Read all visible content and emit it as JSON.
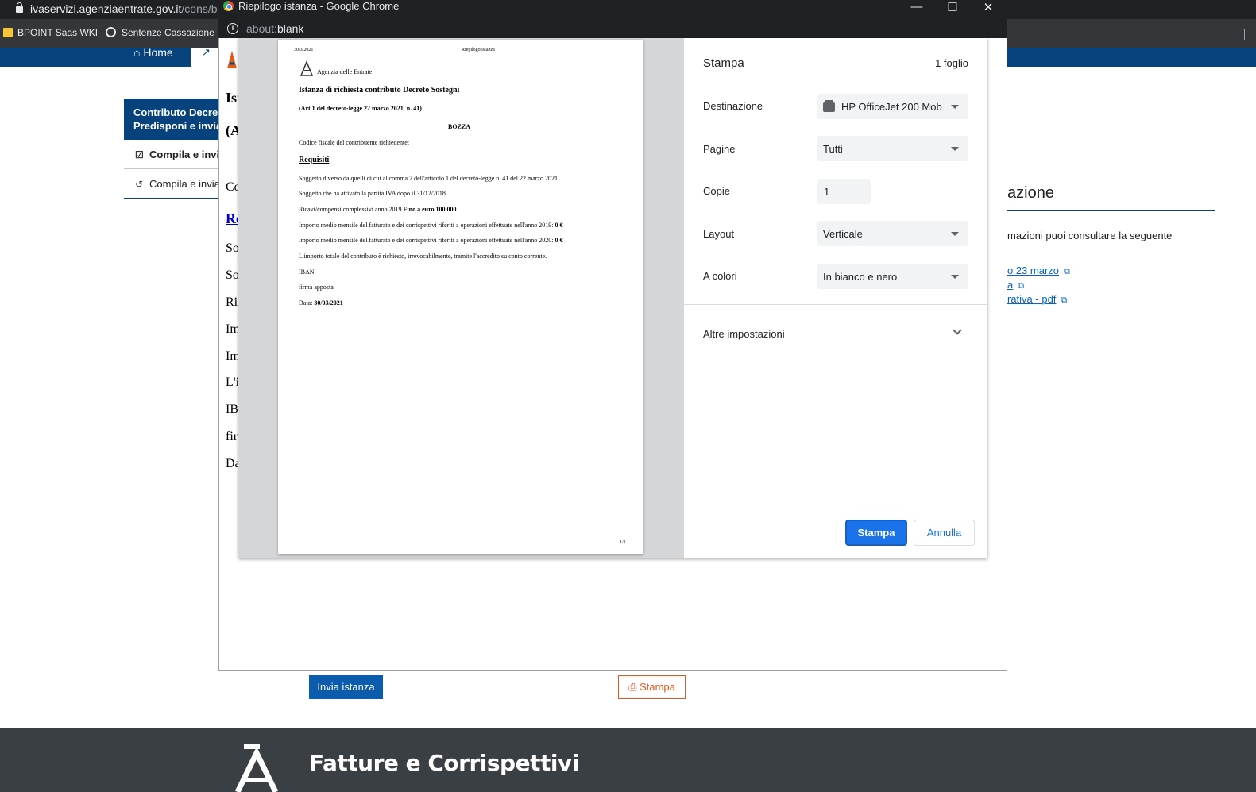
{
  "background_browser": {
    "url_host": "ivaservizi.agenziaentrate.gov.it",
    "url_path": "/cons/bc",
    "bookmarks": [
      "BPOINT Saas WKI",
      "Sentenze Cassazione"
    ]
  },
  "site": {
    "nav": {
      "home": "Home"
    },
    "sidebar": {
      "title_line1": "Contributo Decreto",
      "title_line2": "Predisponi e invia",
      "items": [
        "Compila e invia",
        "Compila e invia"
      ]
    },
    "right_panel": {
      "title": "azione",
      "text": "mazioni puoi consultare la seguente",
      "links": [
        "o 23 marzo",
        "a",
        "rativa - pdf"
      ]
    },
    "popup_underlay": {
      "h1": "Ist",
      "h2": "(A",
      "co": "Co",
      "link": "Re",
      "lines": [
        "So",
        "So",
        "Ri",
        "Im",
        "Im",
        "L'i",
        "IB.",
        "fir",
        "Da"
      ]
    },
    "buttons": {
      "invia": "Invia istanza",
      "stampa": "Stampa"
    },
    "footer": {
      "title": "Fatture e Corrispettivi"
    }
  },
  "popup": {
    "title": "Riepilogo istanza - Google Chrome",
    "address_scheme": "about:",
    "address_rest": "blank"
  },
  "print_preview_page": {
    "header_date": "30/3/2021",
    "header_title": "Riepilogo istanza",
    "agency": "Agenzia delle Entrate",
    "heading": "Istanza di richiesta contributo Decreto Sostegni",
    "subheading": "(Art.1 del decreto-legge 22 marzo 2021, n. 41)",
    "draft": "BOZZA",
    "cf_label": "Codice fiscale del contribuente richiedente:",
    "req_title": "Requisiti",
    "line1": "Soggetto diverso da quelli di cui al comma 2 dell'articolo 1 del decreto-legge n. 41 del 22 marzo 2021",
    "line2": "Soggetto che ha attivato la partita IVA dopo il 31/12/2018",
    "line3_a": "Ricavi/compensi complessivi anno 2019 ",
    "line3_b": "Fino a euro 100.000",
    "line4_a": "Importo medio mensile del fatturato e dei corrispettivi riferiti a operazioni effettuate nell'anno 2019: ",
    "line4_b": "0 €",
    "line5_a": "Importo medio mensile del fatturato e dei corrispettivi riferiti a operazioni effettuate nell'anno 2020: ",
    "line5_b": "0 €",
    "line6": "L'importo totale del contributo è richiesto, irrevocabilmente, tramite l'accredito su conto corrente.",
    "iban": "IBAN:",
    "firma": "firma apposta",
    "data_label": "Data: ",
    "data_value": "30/03/2021",
    "page_num": "1/1"
  },
  "print_settings": {
    "title": "Stampa",
    "sheets": "1 foglio",
    "destination_label": "Destinazione",
    "destination_value": "HP OfficeJet 200 Mob",
    "pages_label": "Pagine",
    "pages_value": "Tutti",
    "copies_label": "Copie",
    "copies_value": "1",
    "layout_label": "Layout",
    "layout_value": "Verticale",
    "color_label": "A colori",
    "color_value": "In bianco e nero",
    "more_settings": "Altre impostazioni",
    "print_button": "Stampa",
    "cancel_button": "Annulla"
  }
}
